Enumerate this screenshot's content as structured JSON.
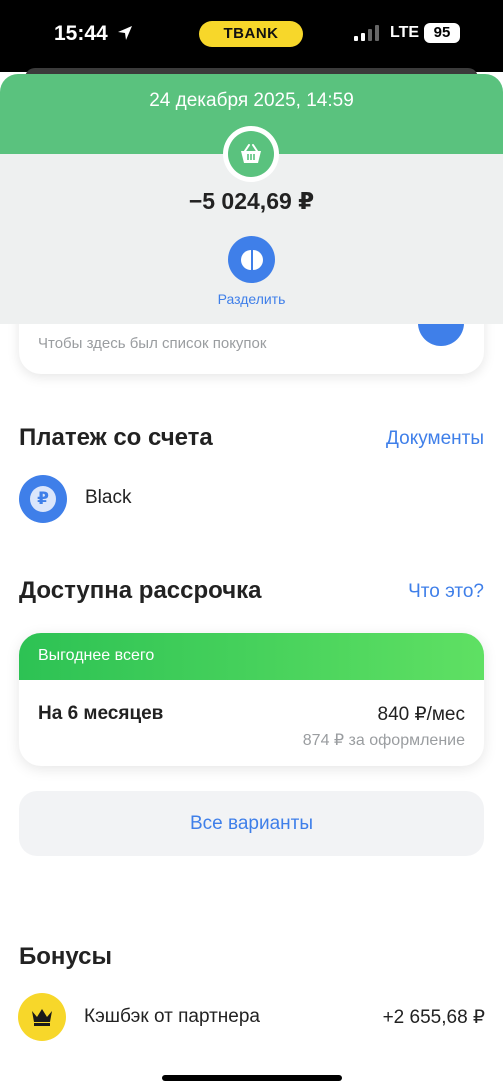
{
  "status_bar": {
    "time": "15:44",
    "brand": "TBANK",
    "network": "LTE",
    "battery": "95"
  },
  "transaction": {
    "datetime": "24 декабря 2025, 14:59",
    "amount": "−5 024,69 ₽",
    "category_icon": "basket-icon",
    "split_label": "Разделить"
  },
  "receipt": {
    "hint": "Чтобы здесь был список покупок"
  },
  "payment": {
    "title": "Платеж со счета",
    "documents_link": "Документы",
    "account_name": "Black",
    "account_icon_glyph": "₽"
  },
  "installment": {
    "title": "Доступна рассрочка",
    "info_link": "Что это?",
    "badge": "Выгоднее всего",
    "term": "На 6 месяцев",
    "monthly": "840 ₽/мес",
    "fee": "874 ₽ за оформление",
    "all_variants": "Все варианты"
  },
  "bonuses": {
    "title": "Бонусы",
    "item_name": "Кэшбэк от партнера",
    "item_amount": "+2 655,68 ₽"
  },
  "colors": {
    "header_green": "#5ac27e",
    "accent_blue": "#3f7fe9",
    "brand_yellow": "#f7d72a"
  }
}
